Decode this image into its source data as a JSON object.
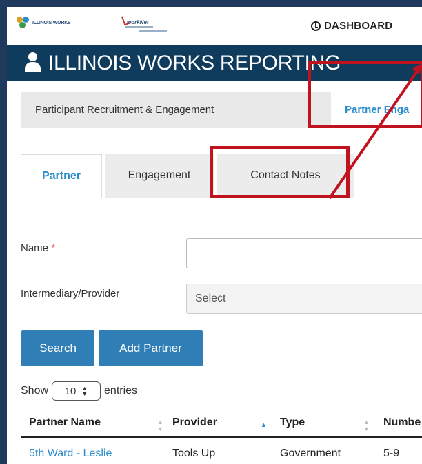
{
  "header": {
    "logo_left_text": "ILLINOIS WORKS",
    "logo_right_text": "workNet",
    "dashboard_label": "DASHBOARD"
  },
  "banner": {
    "title": "ILLINOIS WORKS REPORTING"
  },
  "subnav": {
    "items": [
      {
        "label": "Participant Recruitment & Engagement",
        "active": false
      },
      {
        "label": "Partner Enga",
        "active": true
      }
    ]
  },
  "tabs": [
    {
      "label": "Partner",
      "active": true
    },
    {
      "label": "Engagement",
      "active": false
    },
    {
      "label": "Contact Notes",
      "active": false
    }
  ],
  "form": {
    "name_label": "Name",
    "required_marker": "*",
    "name_value": "",
    "provider_label": "Intermediary/Provider",
    "provider_placeholder": "Select"
  },
  "buttons": {
    "search": "Search",
    "add_partner": "Add Partner"
  },
  "pagination": {
    "show": "Show",
    "entries_value": "10",
    "entries_label": "entries"
  },
  "table": {
    "columns": [
      "Partner Name",
      "Provider",
      "Type",
      "Numbe"
    ],
    "sorted_column": "Provider",
    "rows": [
      [
        "5th Ward - Leslie",
        "Tools Up",
        "Government",
        "5-9"
      ]
    ]
  },
  "colors": {
    "accent": "#2a8ccc",
    "banner": "#0f3b5d",
    "button": "#2f7fb6",
    "highlight": "#c1121f"
  }
}
